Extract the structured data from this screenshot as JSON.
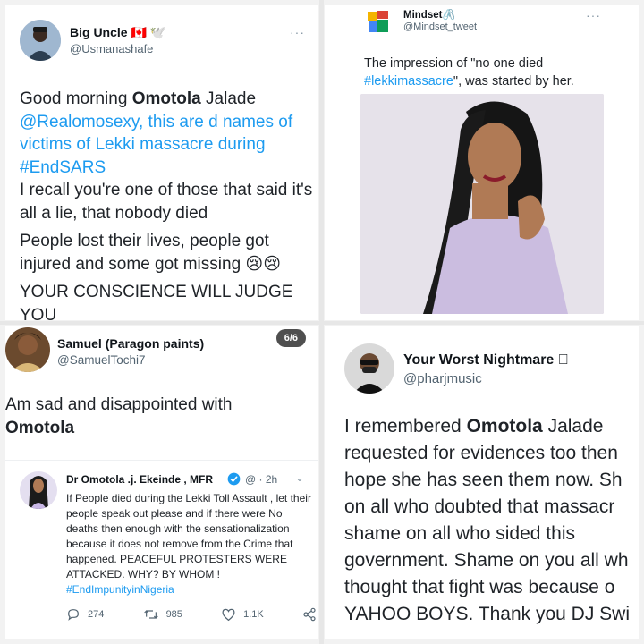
{
  "tweets": {
    "top_left": {
      "name": "Big Uncle 🇨🇦 🕊️",
      "handle": "@Usmanashafe",
      "line1_pre": "Good morning ",
      "line1_bold": "Omotola",
      "line1_post": " Jalade",
      "line2": "@Realomosexy,  this are d names of victims of Lekki massacre during",
      "hashtag": "#EndSARS",
      "para2": "I recall you're one of those that said it's all a lie, that nobody died",
      "para3": "People lost their lives, people got injured and some got missing 😢😢",
      "para4": "YOUR CONSCIENCE WILL JUDGE YOU",
      "more": "···"
    },
    "top_right": {
      "name": "Mindset🖇️",
      "handle": "@Mindset_tweet",
      "text_pre": "The impression of \"no one died",
      "hashtag": "#lekkimassacre",
      "text_post": "\", was started by her.",
      "more": "···"
    },
    "bottom_left": {
      "name": "Samuel (Paragon paints)",
      "handle": "@SamuelTochi7",
      "counter": "6/6",
      "text_pre": "Am sad and disappointed with",
      "text_bold": "Omotola",
      "quote": {
        "name": "Dr Omotola .j. Ekeinde , MFR",
        "meta": "@ · 2h",
        "text": "If People died during the Lekki Toll Assault , let their people speak out please and if there were No deaths then enough with the sensationalization because it does not remove from the Crime that happened. PEACEFUL PROTESTERS WERE ATTACKED. WHY? BY WHOM !",
        "hashtag": "#EndImpunityinNigeria",
        "replies": "274",
        "retweets": "985",
        "likes": "1.1K"
      }
    },
    "bottom_right": {
      "name": "Your Worst Nightmare ",
      "handle": "@pharjmusic",
      "line1_pre": "I remembered ",
      "line1_bold": "Omotola",
      "line1_post": " Jalade",
      "lines": [
        "requested for evidences too then",
        "hope she has seen them now. Sh",
        "on all who doubted that massacr",
        "shame on all who sided this",
        "government. Shame on you all wh",
        "thought that fight was because o",
        "YAHOO BOYS. Thank you DJ Swi"
      ]
    }
  },
  "colors": {
    "link": "#1d9bf0",
    "verified": "#1d9bf0",
    "muted": "#536471"
  }
}
